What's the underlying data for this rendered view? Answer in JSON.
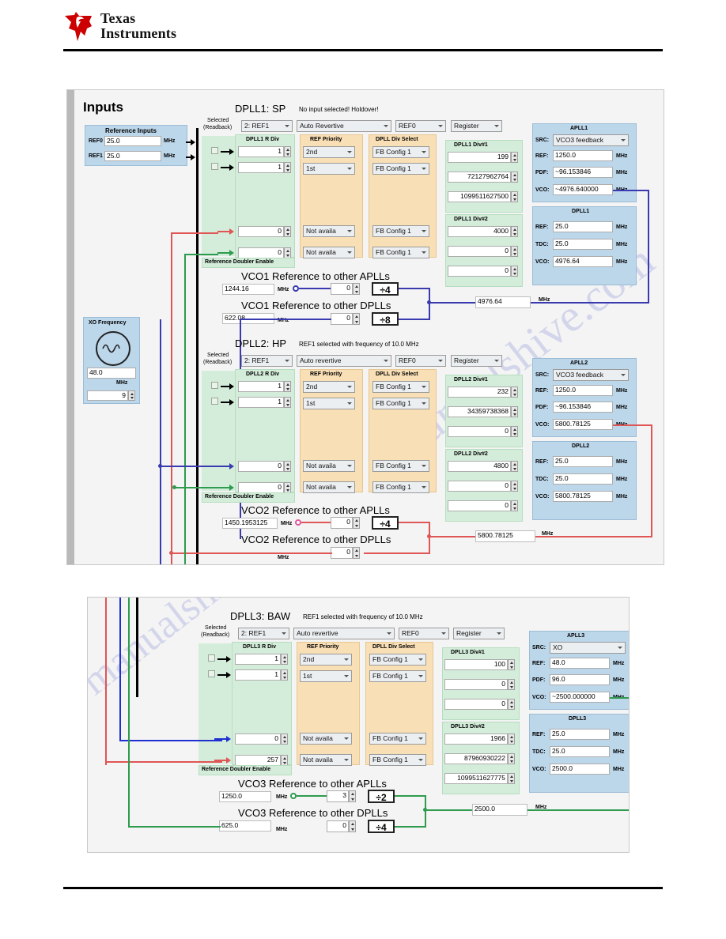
{
  "document": {
    "vendor_logo_text_line1": "Texas",
    "vendor_logo_text_line2": "Instruments",
    "watermark_top": "manualshive.com",
    "watermark_bottom": "manualshive.com"
  },
  "panel_top": {
    "title": "Inputs",
    "reference_inputs": {
      "title": "Reference Inputs",
      "rows": [
        {
          "label": "REF0",
          "value": "25.0",
          "unit": "MHz"
        },
        {
          "label": "REF1",
          "value": "25.0",
          "unit": "MHz"
        }
      ]
    },
    "xo": {
      "title": "XO Frequency",
      "icon": "sine-wave-icon",
      "value": "48.0",
      "unit": "MHz",
      "divider": "9"
    },
    "dplls": [
      {
        "id": "dpll1",
        "name": "DPLL1: SP",
        "status": "No input selected!  Holdover!",
        "selected_label_line1": "Selected",
        "selected_label_line2": "(Readback)",
        "selected_value": "2: REF1",
        "revertive": "Auto Revertive",
        "ref_select": "REF0",
        "source_select": "Register",
        "rdiv": {
          "title": "DPLL1 R Div",
          "values": [
            "1",
            "1",
            "0",
            "0"
          ]
        },
        "ref_priority": {
          "title": "REF Priority",
          "values": [
            "2nd",
            "1st",
            "Not availa",
            "Not availa"
          ]
        },
        "div_select": {
          "title": "DPLL Div Select",
          "values": [
            "FB Config 1",
            "FB Config 1",
            "FB Config 1",
            "FB Config 1"
          ]
        },
        "div1": {
          "title": "DPLL1 Div#1",
          "values": [
            "199",
            "72127962764",
            "1099511627500"
          ]
        },
        "div2": {
          "title": "DPLL1 Div#2",
          "values": [
            "4000",
            "0",
            "0"
          ]
        },
        "apll": {
          "title": "APLL1",
          "src_label": "SRC:",
          "src_value": "VCO3 feedback",
          "rows": [
            {
              "label": "REF:",
              "value": "1250.0",
              "unit": "MHz"
            },
            {
              "label": "PDF:",
              "value": "~96.153846",
              "unit": "MHz"
            },
            {
              "label": "VCO:",
              "value": "~4976.640000",
              "unit": "MHz"
            }
          ]
        },
        "dpll_readout": {
          "title": "DPLL1",
          "rows": [
            {
              "label": "REF:",
              "value": "25.0",
              "unit": "MHz"
            },
            {
              "label": "TDC:",
              "value": "25.0",
              "unit": "MHz"
            },
            {
              "label": "VCO:",
              "value": "4976.64",
              "unit": "MHz"
            }
          ]
        },
        "doubler_label": "Reference Doubler Enable",
        "vco_apll": {
          "title": "VCO1 Reference to other APLLs",
          "value": "1244.16",
          "unit": "MHz",
          "divider_input": "0",
          "divider_block": "÷4"
        },
        "vco_dpll": {
          "title": "VCO1 Reference to other DPLLs",
          "value": "622.08",
          "unit": "MHz",
          "divider_input": "0",
          "divider_block": "÷8"
        },
        "bus_value": "4976.64",
        "bus_unit": "MHz"
      },
      {
        "id": "dpll2",
        "name": "DPLL2: HP",
        "status": "REF1 selected with frequency of 10.0 MHz",
        "selected_label_line1": "Selected",
        "selected_label_line2": "(Readback)",
        "selected_value": "2: REF1",
        "revertive": "Auto revertive",
        "ref_select": "REF0",
        "source_select": "Register",
        "rdiv": {
          "title": "DPLL2 R Div",
          "values": [
            "1",
            "1",
            "0",
            "0"
          ]
        },
        "ref_priority": {
          "title": "REF Priority",
          "values": [
            "2nd",
            "1st",
            "Not availa",
            "Not availa"
          ]
        },
        "div_select": {
          "title": "DPLL Div Select",
          "values": [
            "FB Config 1",
            "FB Config 1",
            "FB Config 1",
            "FB Config 1"
          ]
        },
        "div1": {
          "title": "DPLL2 Div#1",
          "values": [
            "232",
            "34359738368",
            "0"
          ]
        },
        "div2": {
          "title": "DPLL2 Div#2",
          "values": [
            "4800",
            "0",
            "0"
          ]
        },
        "apll": {
          "title": "APLL2",
          "src_label": "SRC:",
          "src_value": "VCO3 feedback",
          "rows": [
            {
              "label": "REF:",
              "value": "1250.0",
              "unit": "MHz"
            },
            {
              "label": "PDF:",
              "value": "~96.153846",
              "unit": "MHz"
            },
            {
              "label": "VCO:",
              "value": "5800.78125",
              "unit": "MHz"
            }
          ]
        },
        "dpll_readout": {
          "title": "DPLL2",
          "rows": [
            {
              "label": "REF:",
              "value": "25.0",
              "unit": "MHz"
            },
            {
              "label": "TDC:",
              "value": "25.0",
              "unit": "MHz"
            },
            {
              "label": "VCO:",
              "value": "5800.78125",
              "unit": "MHz"
            }
          ]
        },
        "doubler_label": "Reference Doubler Enable",
        "vco_apll": {
          "title": "VCO2 Reference to other APLLs",
          "value": "1450.1953125",
          "unit": "MHz",
          "divider_input": "0",
          "divider_block": "÷4"
        },
        "vco_dpll": {
          "title": "VCO2 Reference to other DPLLs",
          "value": "",
          "unit": "MHz",
          "divider_input": "0",
          "divider_block": ""
        },
        "bus_value": "5800.78125",
        "bus_unit": "MHz"
      }
    ]
  },
  "panel_bottom": {
    "dpll": {
      "id": "dpll3",
      "name": "DPLL3: BAW",
      "status": "REF1 selected with frequency of 10.0 MHz",
      "selected_label_line1": "Selected",
      "selected_label_line2": "(Readback)",
      "selected_value": "2: REF1",
      "revertive": "Auto revertive",
      "ref_select": "REF0",
      "source_select": "Register",
      "rdiv": {
        "title": "DPLL3 R Div",
        "values": [
          "1",
          "1",
          "0",
          "257"
        ]
      },
      "ref_priority": {
        "title": "REF Priority",
        "values": [
          "2nd",
          "1st",
          "Not availa",
          "Not availa"
        ]
      },
      "div_select": {
        "title": "DPLL Div Select",
        "values": [
          "FB Config 1",
          "FB Config 1",
          "FB Config 1",
          "FB Config 1"
        ]
      },
      "div1": {
        "title": "DPLL3 Div#1",
        "values": [
          "100",
          "0",
          "0"
        ]
      },
      "div2": {
        "title": "DPLL3 Div#2",
        "values": [
          "1966",
          "87960930222",
          "1099511627775"
        ]
      },
      "apll": {
        "title": "APLL3",
        "src_label": "SRC:",
        "src_value": "XO",
        "rows": [
          {
            "label": "REF:",
            "value": "48.0",
            "unit": "MHz"
          },
          {
            "label": "PDF:",
            "value": "96.0",
            "unit": "MHz"
          },
          {
            "label": "VCO:",
            "value": "~2500.000000",
            "unit": "MHz"
          }
        ]
      },
      "dpll_readout": {
        "title": "DPLL3",
        "rows": [
          {
            "label": "REF:",
            "value": "25.0",
            "unit": "MHz"
          },
          {
            "label": "TDC:",
            "value": "25.0",
            "unit": "MHz"
          },
          {
            "label": "VCO:",
            "value": "2500.0",
            "unit": "MHz"
          }
        ]
      },
      "doubler_label": "Reference Doubler Enable",
      "vco_apll": {
        "title": "VCO3 Reference to other APLLs",
        "value": "1250.0",
        "unit": "MHz",
        "divider_input": "3",
        "divider_block": "÷2"
      },
      "vco_dpll": {
        "title": "VCO3 Reference to other DPLLs",
        "value": "625.0",
        "unit": "MHz",
        "divider_input": "0",
        "divider_block": "÷4"
      },
      "bus_value": "2500.0",
      "bus_unit": "MHz"
    }
  },
  "colors": {
    "ti_red": "#cc0000",
    "group_blue": "#bcd6ea",
    "group_green": "#d4edda",
    "group_orange": "#f9dfb6",
    "wire_blue": "#3a3ab0",
    "wire_red": "#e05555",
    "wire_green": "#2e9b4e",
    "wire_darkblue": "#2030d0"
  }
}
